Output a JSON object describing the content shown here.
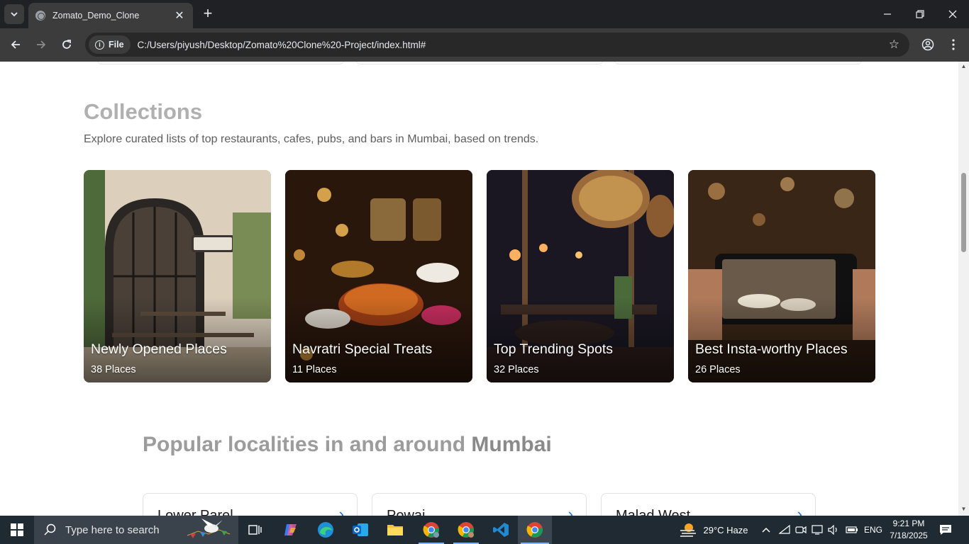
{
  "browser": {
    "tab_title": "Zomato_Demo_Clone",
    "site_chip_label": "File",
    "url": "C:/Users/piyush/Desktop/Zomato%20Clone%20-Project/index.html#"
  },
  "collections": {
    "title": "Collections",
    "subtitle": "Explore curated lists of top restaurants, cafes, pubs, and bars in Mumbai, based on trends.",
    "items": [
      {
        "name": "Newly Opened Places",
        "count": "38 Places"
      },
      {
        "name": "Navratri Special Treats",
        "count": "11 Places"
      },
      {
        "name": "Top Trending Spots",
        "count": "32 Places"
      },
      {
        "name": "Best Insta-worthy Places",
        "count": "26 Places"
      }
    ]
  },
  "localities": {
    "title_prefix": "Popular localities in and around ",
    "title_city": "Mumbai",
    "items": [
      {
        "name": "Lower Parel"
      },
      {
        "name": "Powai"
      },
      {
        "name": "Malad West"
      }
    ]
  },
  "taskbar": {
    "search_placeholder": "Type here to search",
    "weather": "29°C  Haze",
    "language": "ENG",
    "time": "9:21 PM",
    "date": "7/18/2025"
  }
}
